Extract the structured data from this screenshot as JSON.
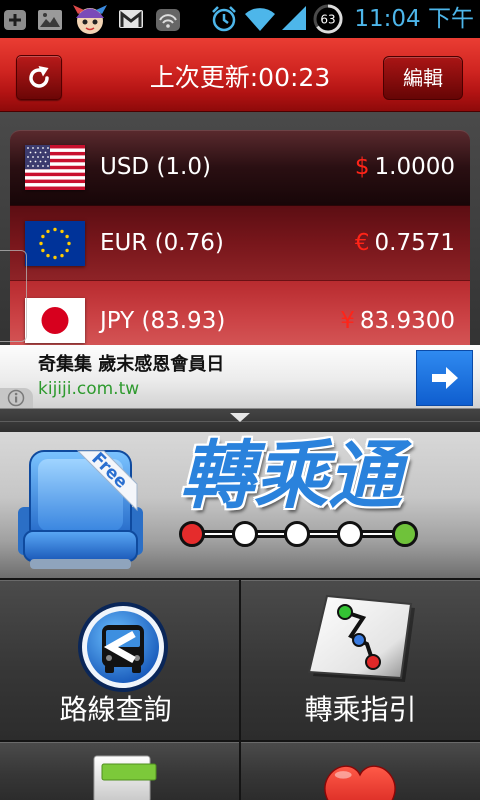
{
  "status_bar": {
    "icons_left": [
      "plus-icon",
      "image-icon",
      "app-avatar-icon",
      "gmail-icon",
      "sync-icon"
    ],
    "icons_right": [
      "alarm-icon",
      "wifi-icon",
      "signal-icon",
      "battery-icon"
    ],
    "battery": "63",
    "time": "11:04 下午",
    "accent_color": "#4db6ea"
  },
  "header": {
    "refresh_icon": "refresh-icon",
    "title": "上次更新:00:23",
    "edit_label": "編輯",
    "color": "#c41a1a"
  },
  "currencies": [
    {
      "flag": "us-flag-icon",
      "label": "USD (1.0)",
      "symbol": "$",
      "value": "1.0000"
    },
    {
      "flag": "eu-flag-icon",
      "label": "EUR (0.76)",
      "symbol": "€",
      "value": "0.7571"
    },
    {
      "flag": "jp-flag-icon",
      "label": "JPY (83.93)",
      "symbol": "¥",
      "value": "83.9300"
    }
  ],
  "ad": {
    "headline": "奇集集 歲末感恩會員日",
    "url": "kijiji.com.tw",
    "url_color": "#2e9a2e",
    "go_icon": "arrow-right-icon",
    "info_icon": "info-icon"
  },
  "promo": {
    "icon": "seat-icon",
    "ribbon": "Free",
    "title": "轉乘通",
    "title_color": "#2a82dc"
  },
  "menu": [
    {
      "label": "路線查詢",
      "icon": "bus-route-icon"
    },
    {
      "label": "轉乘指引",
      "icon": "transfer-map-icon"
    },
    {
      "icon": "folder-icon"
    },
    {
      "icon": "heart-icon"
    }
  ]
}
